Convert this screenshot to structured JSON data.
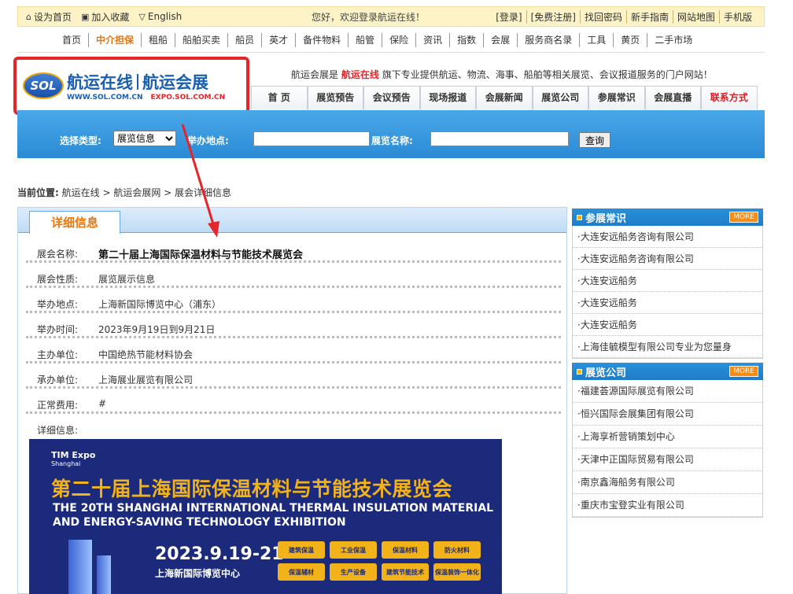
{
  "topbar": {
    "set_home": "设为首页",
    "add_fav": "加入收藏",
    "english": "English",
    "welcome": "您好，欢迎登录航运在线！",
    "links": [
      "[登录]",
      "[免费注册]",
      "找回密码",
      "新手指南",
      "网站地图",
      "手机版"
    ]
  },
  "mainnav": [
    "首页",
    "中介担保",
    "租船",
    "船舶买卖",
    "船员",
    "英才",
    "备件物料",
    "船管",
    "保险",
    "资讯",
    "指数",
    "会展",
    "服务商名录",
    "工具",
    "黄页",
    "二手市场"
  ],
  "logo": {
    "sol": "SOL",
    "name1": "航运在线",
    "name2": "航运会展",
    "url1": "WWW.SOL.COM.CN",
    "url2": "EXPO.SOL.COM.CN"
  },
  "tagline": {
    "pre": "航运会展是",
    "brand": "航运在线",
    "post": "旗下专业提供航运、物流、海事、船舶等相关展览、会议报道服务的门户网站！"
  },
  "subnav": [
    "首 页",
    "展览预告",
    "会议预告",
    "现场报道",
    "会展新闻",
    "展览公司",
    "参展常识",
    "会展直播",
    "联系方式"
  ],
  "search": {
    "type_label": "选择类型:",
    "type_selected": "展览信息",
    "place_label": "举办地点:",
    "name_label": "展览名称:",
    "button": "查询"
  },
  "breadcrumb": {
    "label": "当前位置:",
    "path": "航运在线 > 航运会展网 > 展会详细信息"
  },
  "detail": {
    "tab": "详细信息",
    "rows": [
      {
        "k": "展会名称:",
        "v": "第二十届上海国际保温材料与节能技术展览会"
      },
      {
        "k": "展会性质:",
        "v": "展览展示信息"
      },
      {
        "k": "举办地点:",
        "v": "上海新国际博览中心（浦东）"
      },
      {
        "k": "举办时间:",
        "v": "2023年9月19日到9月21日"
      },
      {
        "k": "主办单位:",
        "v": "中国绝热节能材料协会"
      },
      {
        "k": "承办单位:",
        "v": "上海展业展览有限公司"
      },
      {
        "k": "正常费用:",
        "v": "#"
      },
      {
        "k": "详细信息:",
        "v": ""
      }
    ],
    "banner": {
      "logo": "TIM Expo",
      "logo_sub": "Shanghai",
      "title_zh": "第二十届上海国际保温材料与节能技术展览会",
      "title_en1": "THE 20TH SHANGHAI INTERNATIONAL THERMAL INSULATION MATERIAL",
      "title_en2": "AND ENERGY-SAVING TECHNOLOGY EXHIBITION",
      "date": "2023.9.19-21",
      "venue": "上海新国际博览中心",
      "tags": [
        "建筑保温",
        "工业保温",
        "保温材料",
        "防火材料",
        "保温辅材",
        "生产设备",
        "建筑节能技术",
        "保温装饰一体化"
      ]
    }
  },
  "side": {
    "panel1": {
      "title": "参展常识",
      "more": "MORE",
      "items": [
        "·大连安远船务咨询有限公司",
        "·大连安远船务咨询有限公司",
        "·大连安远船务",
        "·大连安远船务",
        "·大连安远船务",
        "·上海佳毓模型有限公司专业为您量身"
      ]
    },
    "panel2": {
      "title": "展览公司",
      "more": "MORE",
      "items": [
        "·福建荟源国际展览有限公司",
        "·恒兴国际会展集团有限公司",
        "·上海享祈营销策划中心",
        "·天津中正国际贸易有限公司",
        "·南京鑫海船务有限公司",
        "·重庆市宝登实业有限公司"
      ]
    }
  },
  "colors": {
    "accent_orange": "#e8760d",
    "brand_blue": "#1a5fb0",
    "highlight_red": "#e4262a",
    "search_blue": "#2a8bd5"
  }
}
